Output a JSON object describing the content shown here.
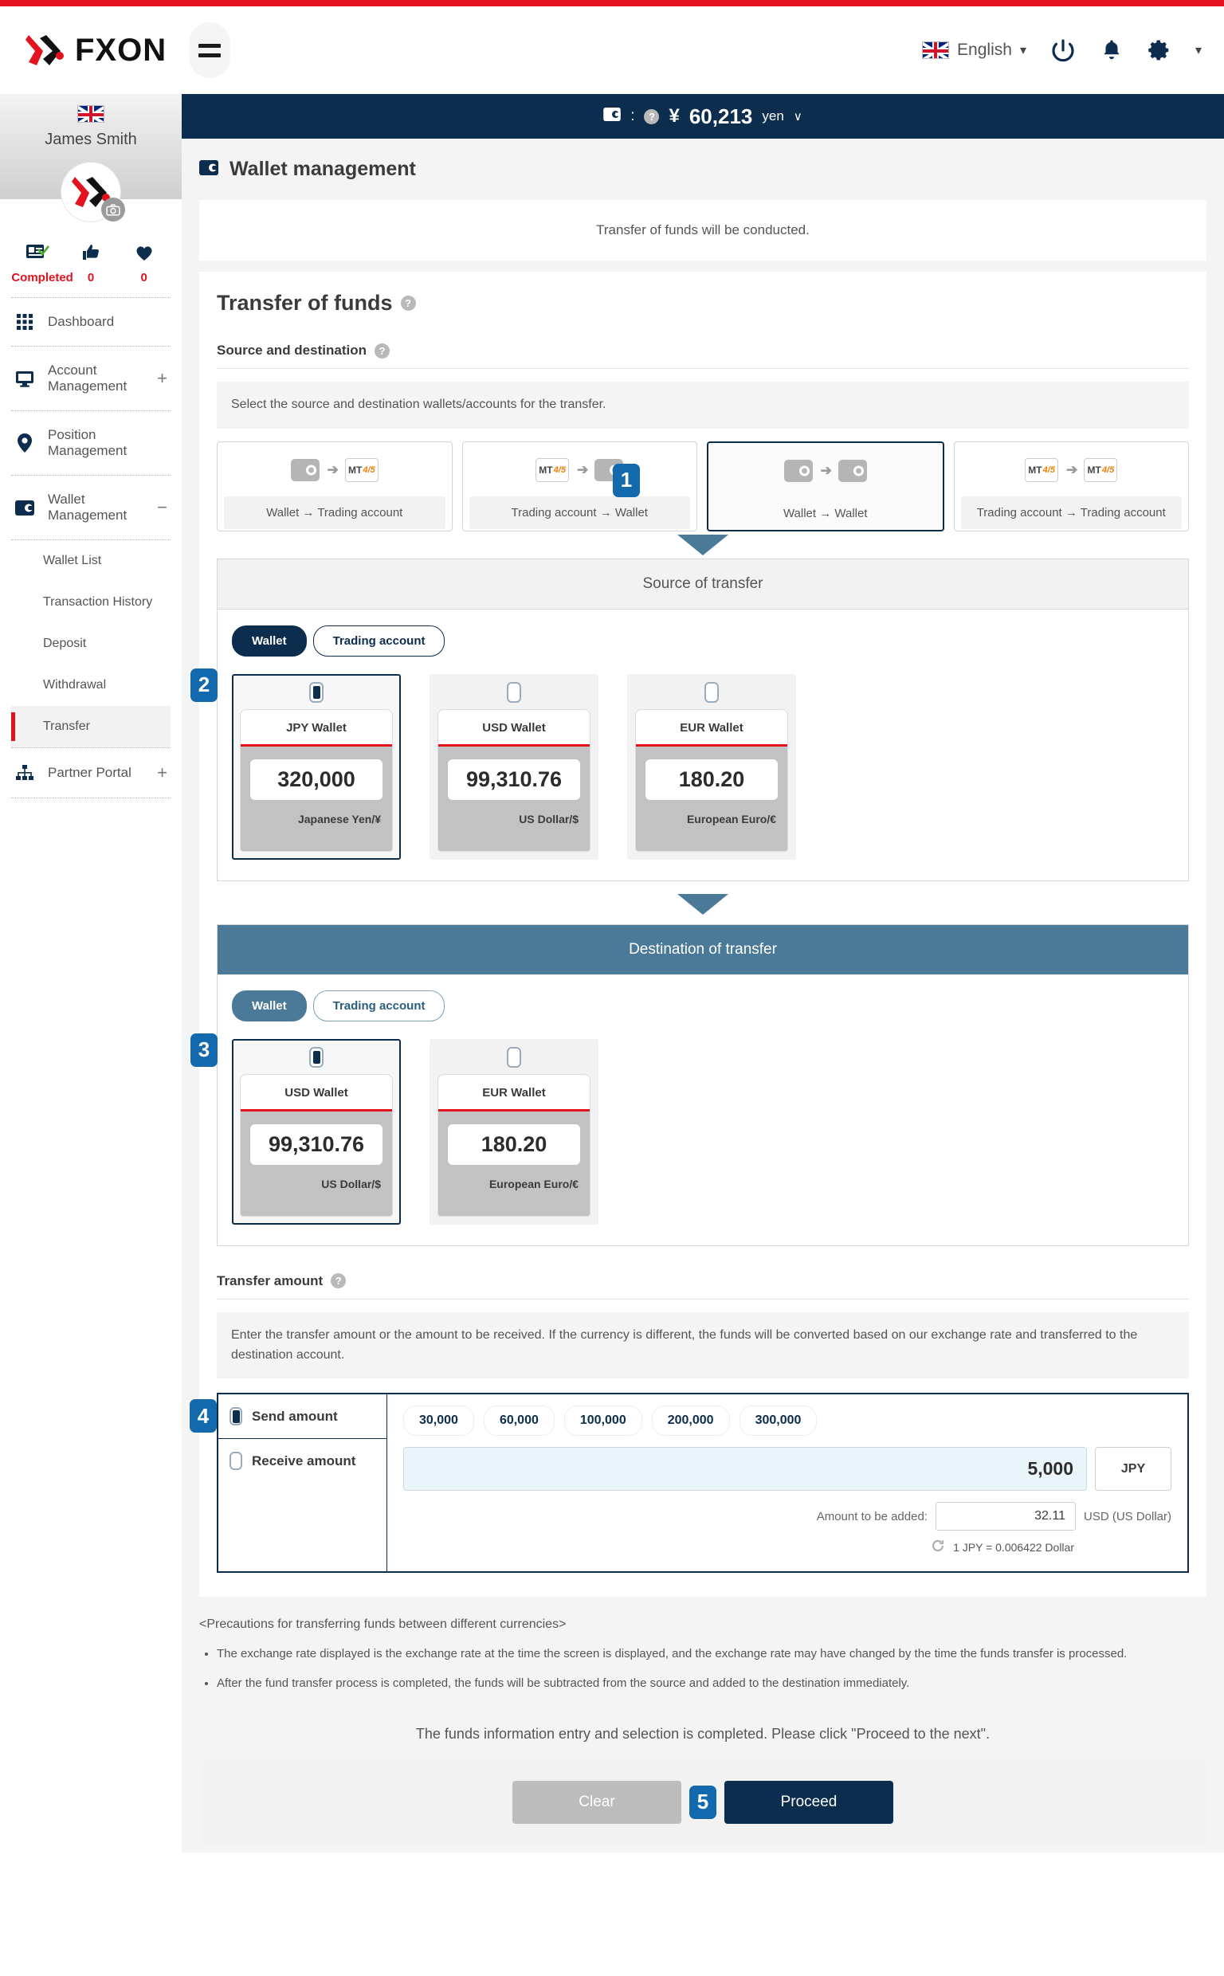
{
  "header": {
    "logo_text": "FXON",
    "language": "English",
    "icons": [
      "power-icon",
      "bell-icon",
      "gear-icon"
    ]
  },
  "sidebar": {
    "user_name": "James Smith",
    "stats": [
      {
        "icon": "id-card-check-icon",
        "value": "Completed"
      },
      {
        "icon": "thumbs-up-icon",
        "value": "0"
      },
      {
        "icon": "heart-icon",
        "value": "0"
      }
    ],
    "nav": [
      {
        "label": "Dashboard",
        "icon": "grid-icon",
        "expand": ""
      },
      {
        "label": "Account Management",
        "icon": "monitor-icon",
        "expand": "+"
      },
      {
        "label": "Position Management",
        "icon": "pin-icon",
        "expand": ""
      },
      {
        "label": "Wallet Management",
        "icon": "wallet-icon",
        "expand": "−"
      }
    ],
    "sub_items": [
      "Wallet List",
      "Transaction History",
      "Deposit",
      "Withdrawal",
      "Transfer"
    ],
    "active_sub": "Transfer",
    "partner": {
      "label": "Partner Portal",
      "icon": "sitemap-icon",
      "expand": "+"
    }
  },
  "balance_bar": {
    "wallet_icon": "wallet-icon",
    "separator": ":",
    "help_icon": "help-icon",
    "currency_symbol": "¥",
    "amount": "60,213",
    "unit": "yen",
    "chevron": "∨"
  },
  "page": {
    "title": "Wallet management",
    "title_icon": "wallet-icon",
    "notice": "Transfer of funds will be conducted.",
    "heading": "Transfer of funds"
  },
  "source_destination": {
    "label": "Source and destination",
    "hint": "Select the source and destination wallets/accounts for the transfer.",
    "types": [
      {
        "label": "Wallet → Trading account",
        "from": "wallet",
        "to": "mt",
        "selected": false
      },
      {
        "label": "Trading account → Wallet",
        "from": "mt",
        "to": "wallet",
        "selected": false
      },
      {
        "label": "Wallet → Wallet",
        "from": "wallet",
        "to": "wallet",
        "selected": true
      },
      {
        "label": "Trading account → Trading account",
        "from": "mt",
        "to": "mt",
        "selected": false
      }
    ],
    "mt_label": "MT",
    "mt_num_top": "4",
    "mt_num_bottom": "5"
  },
  "source": {
    "heading": "Source of transfer",
    "tabs": [
      {
        "label": "Wallet",
        "active": true
      },
      {
        "label": "Trading account",
        "active": false
      }
    ],
    "wallets": [
      {
        "name": "JPY Wallet",
        "amount": "320,000",
        "currency": "Japanese Yen/¥",
        "selected": true
      },
      {
        "name": "USD Wallet",
        "amount": "99,310.76",
        "currency": "US Dollar/$",
        "selected": false
      },
      {
        "name": "EUR Wallet",
        "amount": "180.20",
        "currency": "European Euro/€",
        "selected": false
      }
    ]
  },
  "destination": {
    "heading": "Destination of transfer",
    "tabs": [
      {
        "label": "Wallet",
        "active": true
      },
      {
        "label": "Trading account",
        "active": false
      }
    ],
    "wallets": [
      {
        "name": "USD Wallet",
        "amount": "99,310.76",
        "currency": "US Dollar/$",
        "selected": true
      },
      {
        "name": "EUR Wallet",
        "amount": "180.20",
        "currency": "European Euro/€",
        "selected": false
      }
    ]
  },
  "transfer_amount": {
    "label": "Transfer amount",
    "hint": "Enter the transfer amount or the amount to be received. If the currency is different, the funds will be converted based on our exchange rate and transferred to the destination account.",
    "option_send": "Send amount",
    "option_receive": "Receive amount",
    "quick_amounts": [
      "30,000",
      "60,000",
      "100,000",
      "200,000",
      "300,000"
    ],
    "amount_value": "5,000",
    "amount_currency": "JPY",
    "added_label": "Amount to be added:",
    "added_value": "32.11",
    "added_currency": "USD (US Dollar)",
    "rate_text": "1 JPY = 0.006422 Dollar",
    "refresh_icon": "refresh-icon"
  },
  "precautions": {
    "title": "<Precautions for transferring funds between different currencies>",
    "items": [
      "The exchange rate displayed is the exchange rate at the time the screen is displayed, and the exchange rate may have changed by the time the funds transfer is processed.",
      "After the fund transfer process is completed, the funds will be subtracted from the source and added to the destination immediately."
    ]
  },
  "footer": {
    "ready_message": "The funds information entry and selection is completed. Please click \"Proceed to the next\".",
    "clear_label": "Clear",
    "proceed_label": "Proceed"
  },
  "steps": {
    "s1": "1",
    "s2": "2",
    "s3": "3",
    "s4": "4",
    "s5": "5"
  },
  "colors": {
    "brand_navy": "#0d2d4e",
    "accent_red": "#e3121f",
    "step_blue": "#1269ad",
    "dest_blue": "#4b7a99"
  }
}
